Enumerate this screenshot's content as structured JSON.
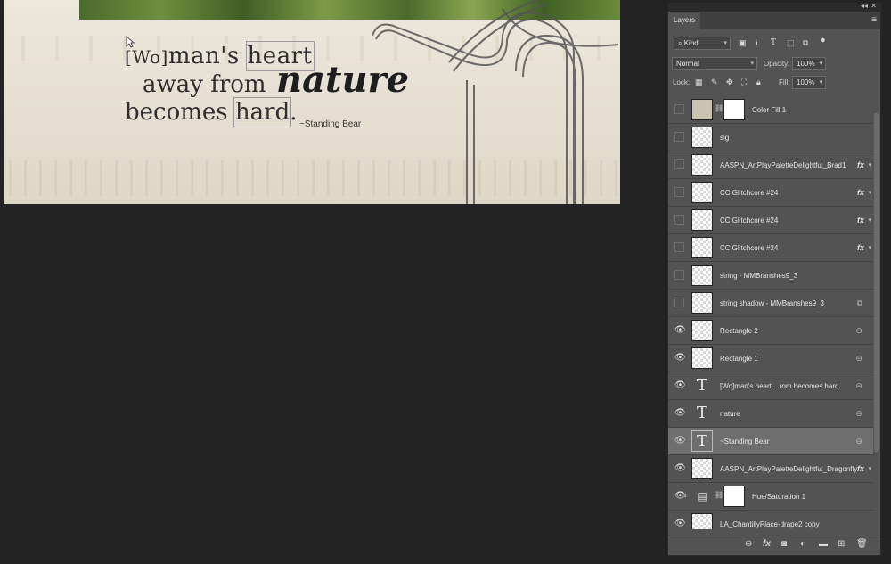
{
  "canvas": {
    "quote_line1_bracket": "[Wo]",
    "quote_line1_rest": "man's ",
    "quote_line1_boxed": "heart",
    "quote_line2": "away from",
    "quote_nature": "nature",
    "quote_line3_start": "becomes ",
    "quote_line3_boxed": "hard",
    "quote_line3_end": ".",
    "attribution": "~Standing Bear"
  },
  "panel": {
    "tab_label": "Layers",
    "filter_kind": "Kind",
    "blend_mode": "Normal",
    "opacity_label": "Opacity:",
    "opacity_value": "100%",
    "lock_label": "Lock:",
    "fill_label": "Fill:",
    "fill_value": "100%"
  },
  "layers": [
    {
      "name": "Color Fill 1",
      "visible": false
    },
    {
      "name": "sig",
      "visible": false
    },
    {
      "name": "AASPN_ArtPlayPaletteDelightful_Brad1",
      "visible": false,
      "fx": "fx"
    },
    {
      "name": "CC Glitchcore #24",
      "visible": false,
      "fx": "fx"
    },
    {
      "name": "CC Glitchcore #24",
      "visible": false,
      "fx": "fx"
    },
    {
      "name": "CC Glitchcore #24",
      "visible": false,
      "fx": "fx"
    },
    {
      "name": "string - MMBranshes9_3",
      "visible": false
    },
    {
      "name": "string shadow - MMBranshes9_3",
      "visible": false
    },
    {
      "name": "Rectangle 2",
      "visible": true
    },
    {
      "name": "Rectangle 1",
      "visible": true
    },
    {
      "name": "[Wo]man's heart   ...rom becomes hard.",
      "visible": true
    },
    {
      "name": "nature",
      "visible": true
    },
    {
      "name": "~Standing Bear",
      "visible": true,
      "selected": true
    },
    {
      "name": "AASPN_ArtPlayPaletteDelightful_Dragonfly",
      "visible": true,
      "fx": "fx"
    },
    {
      "name": "Hue/Saturation 1",
      "visible": true
    },
    {
      "name": "LA_ChantillyPlace-drape2 copy",
      "visible": true
    }
  ],
  "colors": {
    "app_bg": "#232323",
    "panel_bg": "#535353",
    "selected_row": "#6e6e6e"
  }
}
